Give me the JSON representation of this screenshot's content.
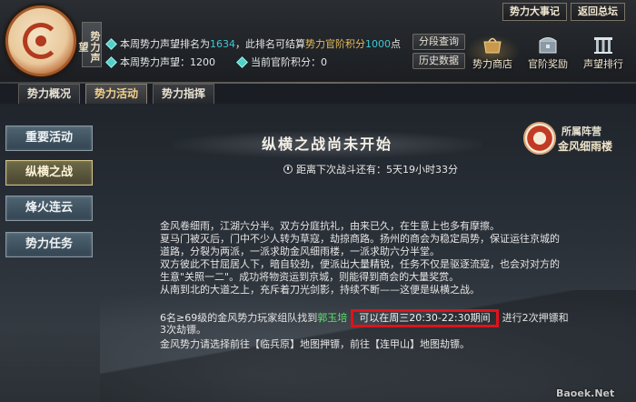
{
  "header": {
    "prestige_tag": "势力声望",
    "line1": {
      "prefix": "本周势力声望排名为",
      "rank": "1634",
      "middle": "，此排名可结算",
      "reward": "势力官阶积分",
      "points": "1000",
      "suffix": "点"
    },
    "line2": {
      "prestige_label": "本周势力声望：",
      "prestige_value": "1200",
      "rank_label": "当前官阶积分：",
      "rank_value": "0"
    },
    "segment_query": "分段查询",
    "history": "历史数据",
    "top_events": "势力大事记",
    "back_hq": "返回总坛",
    "shop": "势力商店",
    "rank_reward": "官阶奖励",
    "prestige_rank": "声望排行"
  },
  "tabs": [
    "势力概况",
    "势力活动",
    "势力指挥"
  ],
  "sidebar": [
    "重要活动",
    "纵横之战",
    "烽火连云",
    "势力任务"
  ],
  "main": {
    "title": "纵横之战尚未开始",
    "countdown_label": "距离下次战斗还有：",
    "countdown_value": "5天19小时33分",
    "camp_label": "所属阵营",
    "camp_name": "金风细雨楼",
    "paragraphs": [
      "金风卷细雨，江湖六分半。双方分庭抗礼，由来已久，在生意上也多有摩擦。",
      "夏马门被灭后，门中不少人转为草寇，劫掠商路。扬州的商会为稳定局势，保证运往京城的",
      "道路，分裂为两派，一派求助金风细雨楼，一派求助六分半堂。",
      "双方彼此不甘屈居人下，暗自较劲，便派出大量精锐，任务不仅是驱逐流寇，也会对对方的",
      "生意\"关照一二\"。成功将物资运到京城，则能得到商会的大量奖赏。",
      "从南到北的大道之上，充斥着刀光剑影，持续不断——这便是纵横之战。"
    ],
    "line7_prefix": "6名≥69级的金风势力玩家组队找到",
    "npc_name": "郭玉培",
    "time_window": "可以在周三20:30-22:30期间",
    "line7_suffix": "进行2次押镖和",
    "line8": "3次劫镖。",
    "line9": "金风势力请选择前往【临兵原】地图押镖，前往【连甲山】地图劫镖。"
  },
  "watermark": "Baoek.Net",
  "colors": {
    "highlight_cyan": "#3fc7d4",
    "highlight_gold": "#e7bd5a",
    "npc_green": "#5fe26e",
    "annotation_red": "#e0121a"
  }
}
